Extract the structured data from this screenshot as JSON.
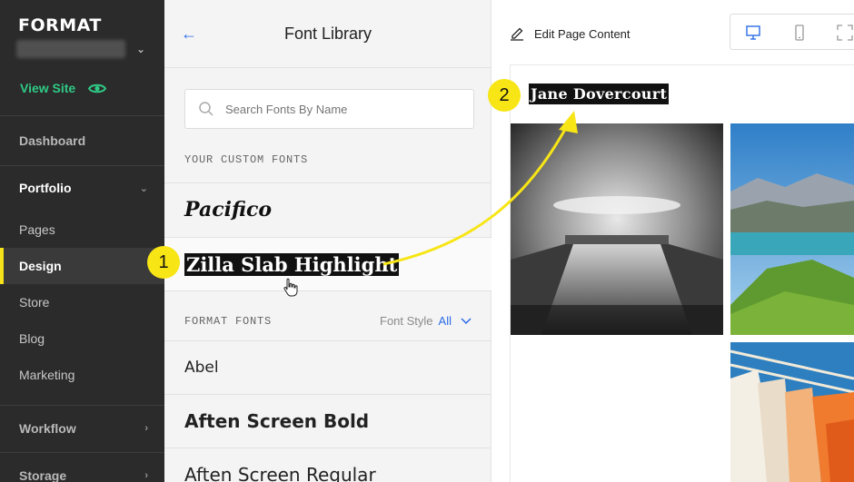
{
  "sidebar": {
    "logo": "FORMAT",
    "view_site": "View Site",
    "items": {
      "dashboard": "Dashboard",
      "portfolio": "Portfolio",
      "pages": "Pages",
      "design": "Design",
      "store": "Store",
      "blog": "Blog",
      "marketing": "Marketing",
      "workflow": "Workflow",
      "storage": "Storage"
    },
    "accent_color": "#2fca86",
    "active_indicator_color": "#f5e21b"
  },
  "font_library": {
    "title": "Font Library",
    "search_placeholder": "Search Fonts By Name",
    "custom_label": "YOUR CUSTOM FONTS",
    "custom_fonts": [
      "Pacifico",
      "Zilla Slab Highlight"
    ],
    "format_label": "FORMAT FONTS",
    "font_style_label": "Font Style",
    "font_style_value": "All",
    "format_fonts": [
      "Abel",
      "Aften Screen Bold",
      "Aften Screen Regular"
    ]
  },
  "preview": {
    "edit_label": "Edit Page Content",
    "site_title": "Jane Dovercourt",
    "devices": [
      "desktop-icon",
      "mobile-icon",
      "fullscreen-icon"
    ]
  },
  "callouts": {
    "one": "1",
    "two": "2",
    "color": "#f7e515"
  }
}
